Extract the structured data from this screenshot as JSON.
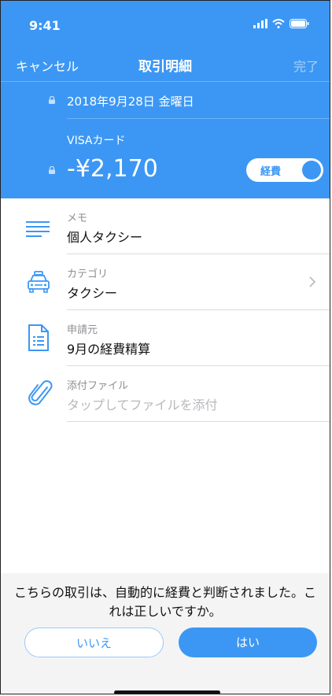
{
  "status_bar": {
    "time": "9:41"
  },
  "nav": {
    "cancel": "キャンセル",
    "title": "取引明細",
    "done": "完了"
  },
  "header": {
    "date": "2018年9月28日 金曜日",
    "card": "VISAカード",
    "amount": "-¥2,170",
    "toggle_label": "経費",
    "toggle_on": true
  },
  "fields": {
    "memo": {
      "label": "メモ",
      "value": "個人タクシー",
      "icon": "lines-icon"
    },
    "category": {
      "label": "カテゴリ",
      "value": "タクシー",
      "icon": "taxi-icon"
    },
    "source": {
      "label": "申請元",
      "value": "9月の経費精算",
      "icon": "document-icon"
    },
    "attachment": {
      "label": "添付ファイル",
      "placeholder": "タップしてファイルを添付",
      "icon": "paperclip-icon"
    }
  },
  "prompt": {
    "message": "こちらの取引は、自動的に経費と判断されました。これは正しいですか。",
    "no": "いいえ",
    "yes": "はい"
  },
  "colors": {
    "accent": "#3c97f4",
    "background": "#ffffff",
    "panel": "#f4f4f5"
  }
}
